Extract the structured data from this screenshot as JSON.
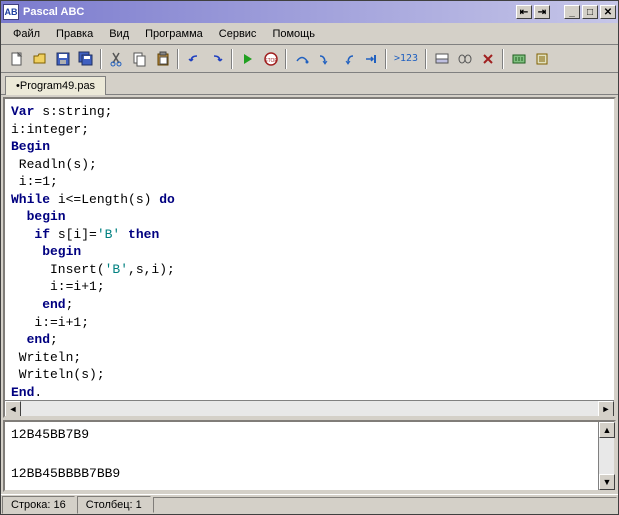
{
  "title": "Pascal ABC",
  "app_icon_label": "AB",
  "menu": [
    "Файл",
    "Правка",
    "Вид",
    "Программа",
    "Сервис",
    "Помощь"
  ],
  "toolbar_icons": [
    "new-file-icon",
    "open-file-icon",
    "save-icon",
    "save-all-icon",
    "sep",
    "cut-icon",
    "copy-icon",
    "paste-icon",
    "sep",
    "undo-icon",
    "redo-icon",
    "sep",
    "run-icon",
    "stop-icon",
    "sep",
    "step-over-icon",
    "step-into-icon",
    "step-out-icon",
    "run-to-cursor-icon",
    "sep",
    "watch-icon",
    "sep",
    "view-output-icon",
    "view-console-icon",
    "close-output-icon",
    "sep",
    "compile-icon",
    "settings-icon"
  ],
  "tab": "•Program49.pas",
  "code": {
    "l1": {
      "t": "Var",
      "s": " s:string;"
    },
    "l2": "i:integer;",
    "l3": {
      "t": "Begin"
    },
    "l4": " Readln(s);",
    "l5": " i:=1;",
    "l6a": {
      "t": "While"
    },
    "l6b": " i<=Length(s) ",
    "l6c": {
      "t": "do"
    },
    "l7": {
      "t": "  begin"
    },
    "l8a": "   ",
    "l8b": {
      "t": "if"
    },
    "l8c": " s[i]=",
    "l8d": {
      "s": "'B'"
    },
    "l8e": " ",
    "l8f": {
      "t": "then"
    },
    "l9": {
      "t": "    begin"
    },
    "l10a": "     Insert(",
    "l10b": {
      "s": "'B'"
    },
    "l10c": ",s,i);",
    "l11": "     i:=i+1;",
    "l12": {
      "t": "    end"
    },
    "l12b": ";",
    "l13": "   i:=i+1;",
    "l14": {
      "t": "  end"
    },
    "l14b": ";",
    "l15": " Writeln;",
    "l16": " Writeln(s);",
    "l17": {
      "t": "End"
    },
    "l17b": "."
  },
  "output": {
    "line1": "12B45BB7B9",
    "line2": "",
    "line3": "12BB45BBBB7BB9"
  },
  "status": {
    "line_label": "Строка: 16",
    "col_label": "Столбец: 1"
  }
}
